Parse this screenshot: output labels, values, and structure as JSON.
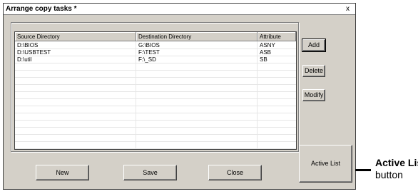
{
  "window": {
    "title": "Arrange copy tasks *",
    "close_label": "x"
  },
  "table": {
    "columns": [
      "Source Directory",
      "Destination Directory",
      "Attribute"
    ],
    "rows": [
      [
        "D:\\BIOS",
        "G:\\BIOS",
        "ASNY"
      ],
      [
        "D:\\USBTEST",
        "F:\\TEST",
        "ASB"
      ],
      [
        "D:\\util",
        "F:\\_SD",
        "SB"
      ]
    ]
  },
  "buttons": {
    "add": "Add",
    "delete": "Delete",
    "modify": "Modify",
    "active_list": "Active List",
    "new": "New",
    "save": "Save",
    "close": "Close"
  },
  "callout": {
    "title": "Active List",
    "subtitle": "button"
  }
}
